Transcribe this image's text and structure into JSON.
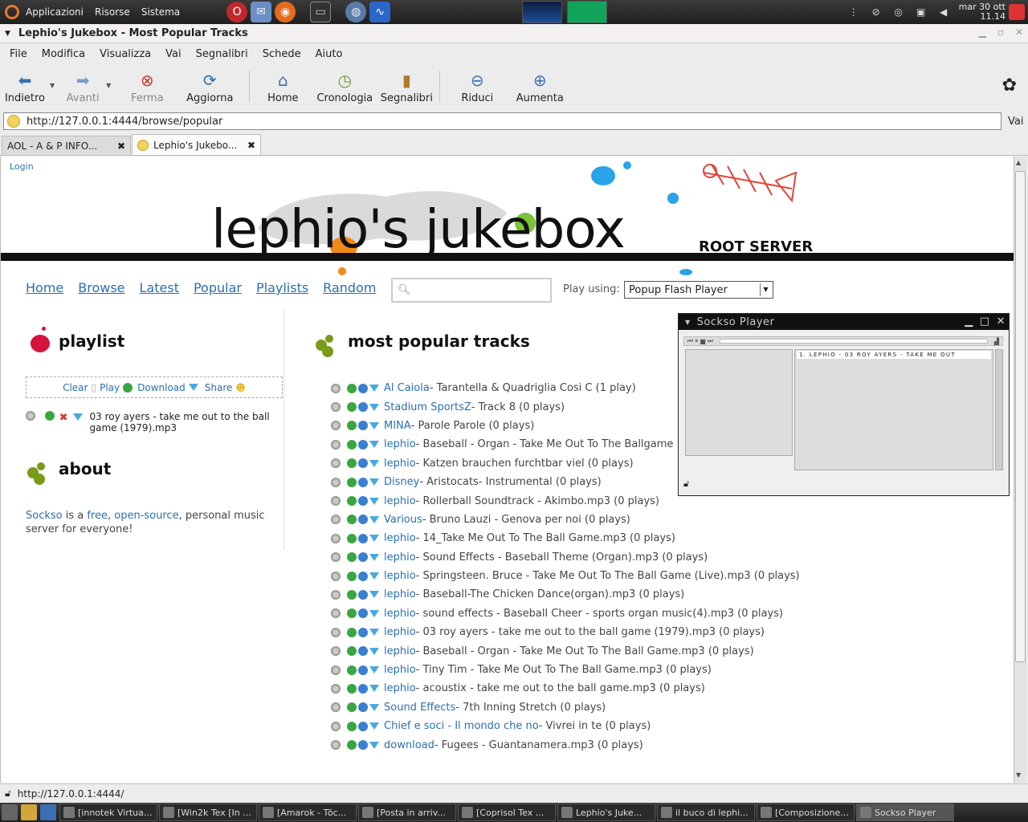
{
  "panel": {
    "menus": [
      "Applicazioni",
      "Risorse",
      "Sistema"
    ],
    "clock_date": "mar 30 ott",
    "clock_time": "11.14"
  },
  "window": {
    "title": "Lephio's Jukebox - Most Popular Tracks"
  },
  "menubar": [
    "File",
    "Modifica",
    "Visualizza",
    "Vai",
    "Segnalibri",
    "Schede",
    "Aiuto"
  ],
  "toolbar": {
    "back": "Indietro",
    "forward": "Avanti",
    "stop": "Ferma",
    "reload": "Aggiorna",
    "home": "Home",
    "history": "Cronologia",
    "bookmarks": "Segnalibri",
    "zoom_out": "Riduci",
    "zoom_in": "Aumenta"
  },
  "urlbar": {
    "url": "http://127.0.0.1:4444/browse/popular",
    "go": "Vai"
  },
  "tabs": [
    {
      "label": "AOL - A & P INFO..."
    },
    {
      "label": "Lephio's Jukebo..."
    }
  ],
  "page": {
    "login": "Login",
    "logo": "lephio's jukebox",
    "server": "ROOT SERVER",
    "nav": [
      "Home",
      "Browse",
      "Latest",
      "Popular",
      "Playlists",
      "Random"
    ],
    "search_placeholder": "",
    "play_using_label": "Play using:",
    "play_using_value": "Popup Flash Player",
    "playlist": {
      "title": "playlist",
      "actions": [
        "Clear",
        "Play",
        "Download",
        "Share"
      ],
      "items": [
        "03 roy ayers - take me out to the ball game (1979).mp3"
      ]
    },
    "about": {
      "title": "about",
      "sockso": "Sockso",
      "is_a": " is a ",
      "free": "free",
      "comma": ", ",
      "open_source": "open-source",
      "rest": ", personal music server for everyone!"
    },
    "main_title": "most popular tracks",
    "tracks": [
      {
        "artist": "Al Caiola",
        "rest": " - Tarantella & Quadriglia Cosi C (1 play)"
      },
      {
        "artist": "Stadium SportsZ",
        "rest": " - Track 8 (0 plays)"
      },
      {
        "artist": "MINA",
        "rest": " - Parole Parole (0 plays)"
      },
      {
        "artist": "lephio",
        "rest": " - Baseball - Organ - Take Me Out To The Ballgame"
      },
      {
        "artist": "lephio",
        "rest": " - Katzen brauchen furchtbar viel (0 plays)"
      },
      {
        "artist": "Disney",
        "rest": " - Aristocats- Instrumental (0 plays)"
      },
      {
        "artist": "lephio",
        "rest": " - Rollerball Soundtrack - Akimbo.mp3 (0 plays)"
      },
      {
        "artist": "Various",
        "rest": " - Bruno Lauzi - Genova per noi (0 plays)"
      },
      {
        "artist": "lephio",
        "rest": " - 14_Take Me Out To The Ball Game.mp3 (0 plays)"
      },
      {
        "artist": "lephio",
        "rest": " - Sound Effects - Baseball Theme (Organ).mp3 (0 plays)"
      },
      {
        "artist": "lephio",
        "rest": " - Springsteen. Bruce - Take Me Out To The Ball Game (Live).mp3 (0 plays)"
      },
      {
        "artist": "lephio",
        "rest": " - Baseball-The Chicken Dance(organ).mp3 (0 plays)"
      },
      {
        "artist": "lephio",
        "rest": " - sound effects - Baseball Cheer - sports organ music(4).mp3 (0 plays)"
      },
      {
        "artist": "lephio",
        "rest": " - 03 roy ayers - take me out to the ball game (1979).mp3 (0 plays)"
      },
      {
        "artist": "lephio",
        "rest": " - Baseball - Organ - Take Me Out To The Ball Game.mp3 (0 plays)"
      },
      {
        "artist": "lephio",
        "rest": " - Tiny Tim - Take Me Out To The Ball Game.mp3 (0 plays)"
      },
      {
        "artist": "lephio",
        "rest": " - acoustix - take me out to the ball game.mp3 (0 plays)"
      },
      {
        "artist": "Sound Effects",
        "rest": " - 7th Inning Stretch (0 plays)"
      },
      {
        "artist": "Chief e soci - Il mondo che no",
        "rest": " - Vivrei in te (0 plays)"
      },
      {
        "artist": "download",
        "rest": " - Fugees - Guantanamera.mp3 (0 plays)"
      }
    ]
  },
  "sockso": {
    "title": "Sockso Player",
    "now_playing": "1. LEPHIO - 03 ROY AYERS - TAKE ME OUT"
  },
  "statusbar": {
    "text": "http://127.0.0.1:4444/"
  },
  "taskbar": [
    "[innotek Virtua...",
    "[Win2k Tex [In ...",
    "[Amarok - Töc...",
    "[Posta in arriv...",
    "[Coprisol Tex ...",
    "Lephio's Juke...",
    "il buco di lephi...",
    "[Composizione...",
    "Sockso Player"
  ]
}
